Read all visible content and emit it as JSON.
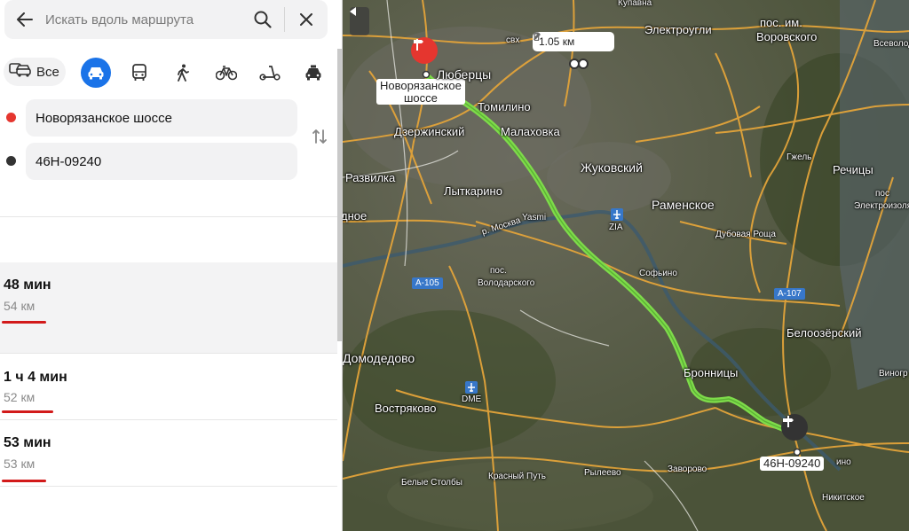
{
  "search": {
    "placeholder": "Искать вдоль маршрута"
  },
  "modes": {
    "all_label": "Все"
  },
  "waypoints": {
    "from": "Новорязанское шоссе",
    "to": "46Н-09240"
  },
  "routes": [
    {
      "time": "48 мин",
      "distance": "54 км"
    },
    {
      "time": "1 ч 4 мин",
      "distance": "52 км"
    },
    {
      "time": "53 мин",
      "distance": "53 км"
    }
  ],
  "map": {
    "measure_label": "1.05 км",
    "start_label_line1": "Новорязанское",
    "start_label_line2": "шоссе",
    "end_label": "46Н-09240",
    "places": {
      "kupavna": "Купавна",
      "elektrougli": "Электроугли",
      "pos_im": "пос. им.",
      "vorovskogo": "Воровского",
      "vsevolod": "Всеволод",
      "lyubertsy": "Люберцы",
      "tomilino": "Томилино",
      "malakhovka": "Малаховка",
      "dzerzhinsky": "Дзержинский",
      "zhukovsky": "Жуковский",
      "ramenskoe": "Раменское",
      "razvilka": "Развилка",
      "lytkarino": "Лыткарино",
      "noe": "дное",
      "dubovaya": "Дубовая Роща",
      "gzhel": "Гжель",
      "rechitsy": "Речицы",
      "pos": "пос",
      "elektroizol": "Электроизоля",
      "pos_volod1": "пос.",
      "pos_volod2": "Володарского",
      "sofino": "Софьино",
      "beloozersky": "Белоозёрский",
      "domodedovo": "Домодедово",
      "bronnitsy": "Бронницы",
      "vinogr": "Виногр",
      "vostryakovo": "Востряково",
      "belye": "Белые Столбы",
      "krasny": "Красный Путь",
      "ryleevo": "Рылеево",
      "zavorovo": "Заворово",
      "nikitskoe": "Никитское",
      "ino": "ино",
      "svkh": "свх",
      "river": "р. Москва",
      "yasmi": "Yasmi"
    },
    "shields": {
      "a105": "А-105",
      "a107": "А-107",
      "dme": "DME",
      "zia": "ZIA"
    }
  }
}
